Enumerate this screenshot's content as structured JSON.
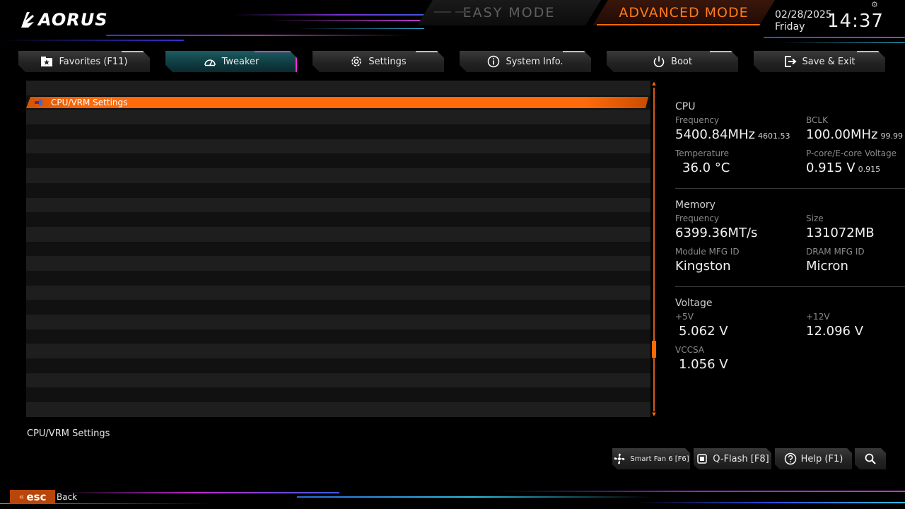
{
  "brand": {
    "logo_text": "AORUS"
  },
  "modes": {
    "easy_label": "EASY MODE",
    "advanced_label": "ADVANCED MODE"
  },
  "datetime": {
    "date": "02/28/2025",
    "day": "Friday",
    "time": "14:37"
  },
  "tabs": [
    {
      "label": "Favorites (F11)",
      "icon": "star-folder-icon"
    },
    {
      "label": "Tweaker",
      "icon": "speedometer-icon",
      "active": true
    },
    {
      "label": "Settings",
      "icon": "gear-icon"
    },
    {
      "label": "System Info.",
      "icon": "info-icon"
    },
    {
      "label": "Boot",
      "icon": "power-icon"
    },
    {
      "label": "Save & Exit",
      "icon": "exit-icon"
    }
  ],
  "menu": {
    "selected_item": "CPU/VRM Settings",
    "help_text": "CPU/VRM Settings"
  },
  "info": {
    "cpu": {
      "title": "CPU",
      "frequency_label": "Frequency",
      "frequency": "5400.84MHz",
      "frequency_sub": "4601.53",
      "bclk_label": "BCLK",
      "bclk": "100.00MHz",
      "bclk_sub": "99.99",
      "temp_label": "Temperature",
      "temp": "36.0 °C",
      "voltage_label": "P-core/E-core Voltage",
      "voltage": "0.915 V",
      "voltage_sub": "0.915"
    },
    "memory": {
      "title": "Memory",
      "frequency_label": "Frequency",
      "frequency": "6399.36MT/s",
      "size_label": "Size",
      "size": "131072MB",
      "module_label": "Module MFG ID",
      "module": "Kingston",
      "dram_label": "DRAM MFG ID",
      "dram": "Micron"
    },
    "voltage": {
      "title": "Voltage",
      "v5_label": "+5V",
      "v5": "5.062 V",
      "v12_label": "+12V",
      "v12": "12.096 V",
      "vccsa_label": "VCCSA",
      "vccsa": "1.056 V"
    }
  },
  "bottom_buttons": {
    "smart_fan": "Smart Fan 6 [F6]",
    "qflash": "Q-Flash [F8]",
    "help": "Help (F1)"
  },
  "esc": {
    "key": "esc",
    "label": "Back"
  },
  "colors": {
    "accent": "#ff6a00",
    "active_tab": "#1b5c60",
    "active_tab_edge": "#ff2bd6"
  }
}
